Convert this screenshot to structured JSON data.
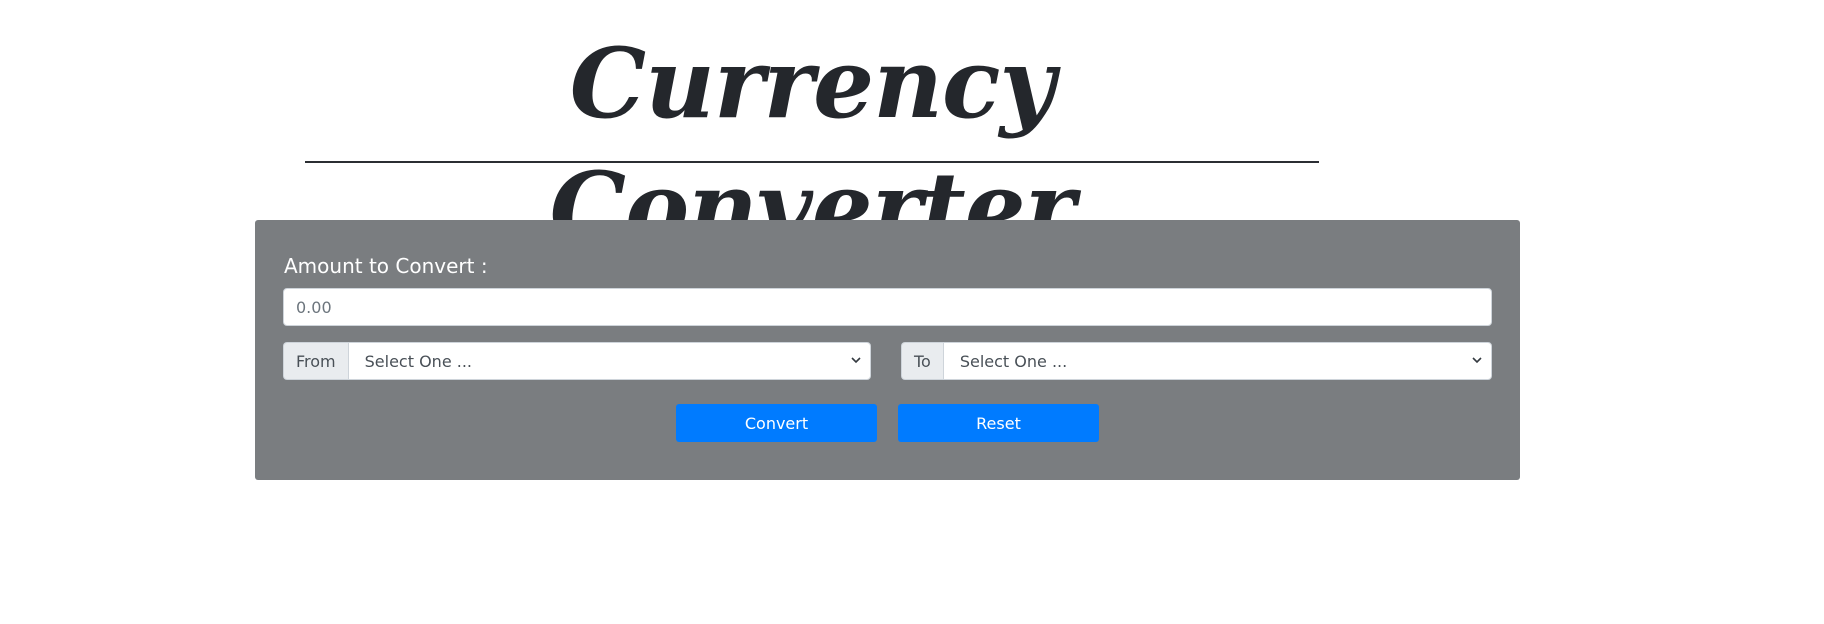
{
  "header": {
    "title": "Currency Converter"
  },
  "form": {
    "amount_label": "Amount to Convert :",
    "amount_placeholder": "0.00",
    "from": {
      "label": "From",
      "selected": "Select One ..."
    },
    "to": {
      "label": "To",
      "selected": "Select One ..."
    },
    "buttons": {
      "convert": "Convert",
      "reset": "Reset"
    }
  },
  "colors": {
    "panel_bg": "#7a7d80",
    "button_primary": "#007bff",
    "title_text": "#24272c"
  },
  "icons": {
    "select_arrow": "chevron-down-icon"
  }
}
